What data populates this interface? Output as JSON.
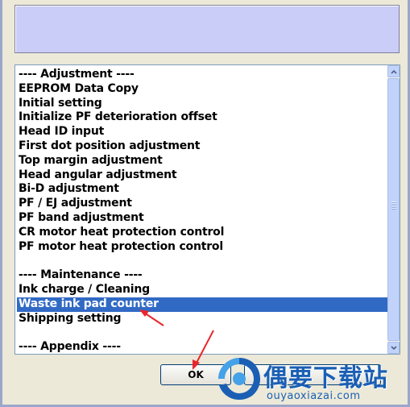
{
  "message_box": {
    "text": ""
  },
  "list": {
    "items": [
      "---- Adjustment ----",
      "EEPROM Data Copy",
      "Initial setting",
      "Initialize PF deterioration offset",
      "Head ID input",
      "First dot position adjustment",
      "Top margin adjustment",
      "Head angular adjustment",
      "Bi-D adjustment",
      "PF / EJ adjustment",
      "PF band adjustment",
      "CR motor heat protection control",
      "PF motor heat protection control",
      "",
      "---- Maintenance ----",
      "Ink charge / Cleaning",
      "Waste ink pad counter",
      "Shipping setting",
      "",
      "---- Appendix ----"
    ],
    "selected": "Waste ink pad counter"
  },
  "buttons": {
    "ok_label": "OK"
  },
  "watermark": {
    "title": "偶要下载站",
    "url": "ouyaoxiazai.com"
  },
  "colors": {
    "selection": "#316ac5",
    "arrow": "#e8262d",
    "brand": "#1a5fb4"
  },
  "icons": {
    "scroll_up": "chevron-up-icon",
    "scroll_down": "chevron-down-icon",
    "annotation": "red-arrow-icon",
    "logo": "ouyao-logo-icon"
  }
}
